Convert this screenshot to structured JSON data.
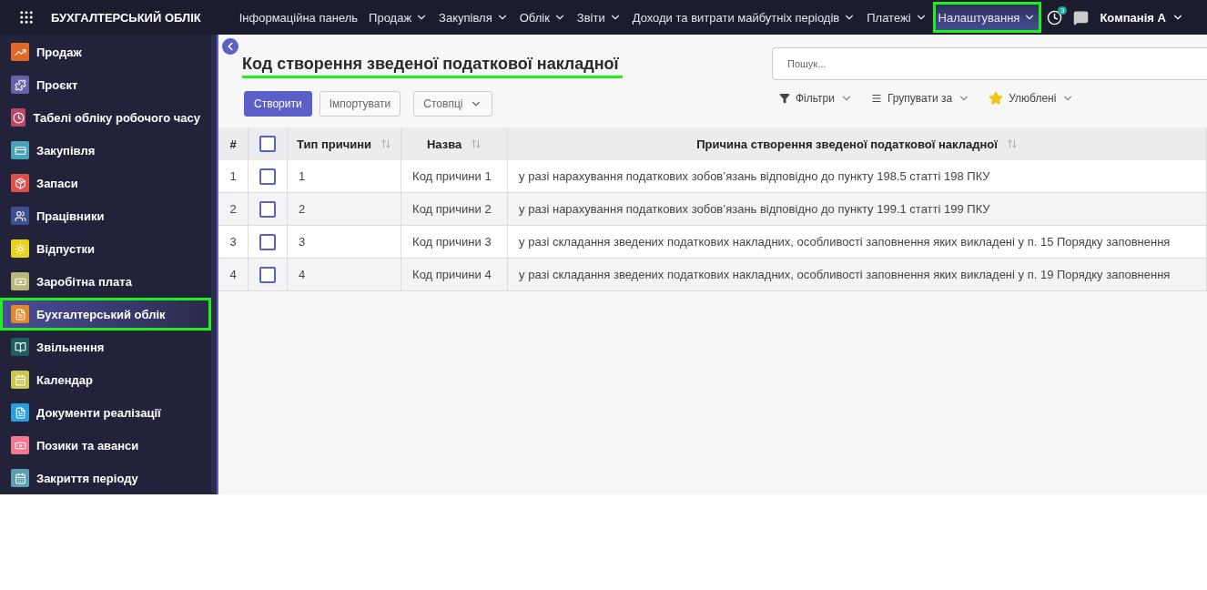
{
  "topbar": {
    "app_title": "БУХГАЛТЕРСЬКИЙ ОБЛІК",
    "menu": [
      {
        "label": "Інформаційна панель",
        "dropdown": false,
        "selected": false
      },
      {
        "label": "Продаж",
        "dropdown": true,
        "selected": false
      },
      {
        "label": "Закупівля",
        "dropdown": true,
        "selected": false
      },
      {
        "label": "Облік",
        "dropdown": true,
        "selected": false
      },
      {
        "label": "Звіти",
        "dropdown": true,
        "selected": false
      },
      {
        "label": "Доходи та витрати майбутніх періодів",
        "dropdown": true,
        "selected": false
      },
      {
        "label": "Платежі",
        "dropdown": true,
        "selected": false
      },
      {
        "label": "Налаштування",
        "dropdown": true,
        "selected": true
      }
    ],
    "activity_count": "3",
    "company": "Компанія А"
  },
  "sidebar": {
    "items": [
      {
        "label": "Продаж",
        "color": "#e0692a",
        "kind": "chart",
        "selected": false
      },
      {
        "label": "Проєкт",
        "color": "#6a62a8",
        "kind": "puzzle",
        "selected": false
      },
      {
        "label": "Табелі обліку робочого часу",
        "color": "#b84a6a",
        "kind": "clock",
        "selected": false
      },
      {
        "label": "Закупівля",
        "color": "#4aa3b5",
        "kind": "card",
        "selected": false
      },
      {
        "label": "Запаси",
        "color": "#e04e4e",
        "kind": "box",
        "selected": false
      },
      {
        "label": "Працівники",
        "color": "#3e4e8e",
        "kind": "people",
        "selected": false
      },
      {
        "label": "Відпустки",
        "color": "#e8d420",
        "kind": "sun",
        "selected": false
      },
      {
        "label": "Заробітна плата",
        "color": "#b8b878",
        "kind": "money",
        "selected": false
      },
      {
        "label": "Бухгалтерський облік",
        "color": "#e08a2a",
        "kind": "doc",
        "selected": true
      },
      {
        "label": "Звільнення",
        "color": "#1e5e5e",
        "kind": "book",
        "selected": false
      },
      {
        "label": "Календар",
        "color": "#c8c850",
        "kind": "calendar",
        "selected": false
      },
      {
        "label": "Документи реалізації",
        "color": "#2a9ee0",
        "kind": "doc",
        "selected": false
      },
      {
        "label": "Позики та аванси",
        "color": "#f07890",
        "kind": "money",
        "selected": false
      },
      {
        "label": "Закриття періоду",
        "color": "#5aa0b0",
        "kind": "calendar",
        "selected": false
      }
    ]
  },
  "page": {
    "title": "Код створення зведеної податкової накладної",
    "buttons": {
      "create": "Створити",
      "import": "Імпортувати",
      "columns": "Стовпці"
    },
    "search": {
      "placeholder": "Пошук..."
    },
    "filters": [
      {
        "label": "Фільтри",
        "kind": "filter"
      },
      {
        "label": "Групувати за",
        "kind": "group"
      },
      {
        "label": "Улюблені",
        "kind": "star"
      }
    ],
    "table": {
      "select_all_checked": false,
      "columns": [
        "#",
        "Тип причини",
        "Назва",
        "Причина створення зведеної податкової накладної"
      ],
      "rows": [
        {
          "index": "1",
          "checked": false,
          "type": "1",
          "name": "Код причини 1",
          "reason": "у разі нарахування податкових зобов’язань відповідно до пункту 198.5 статті 198 ПКУ"
        },
        {
          "index": "2",
          "checked": false,
          "type": "2",
          "name": "Код причини 2",
          "reason": "у разі нарахування податкових зобов’язань відповідно до пункту 199.1 статті 199 ПКУ"
        },
        {
          "index": "3",
          "checked": false,
          "type": "3",
          "name": "Код причини 3",
          "reason": "у разі складання зведених податкових накладних, особливості заповнення яких викладені у п. 15 Порядку заповнення"
        },
        {
          "index": "4",
          "checked": false,
          "type": "4",
          "name": "Код причини 4",
          "reason": "у разі складання зведених податкових накладних, особливості заповнення яких викладені у п. 19 Порядку заповнення"
        }
      ]
    }
  }
}
